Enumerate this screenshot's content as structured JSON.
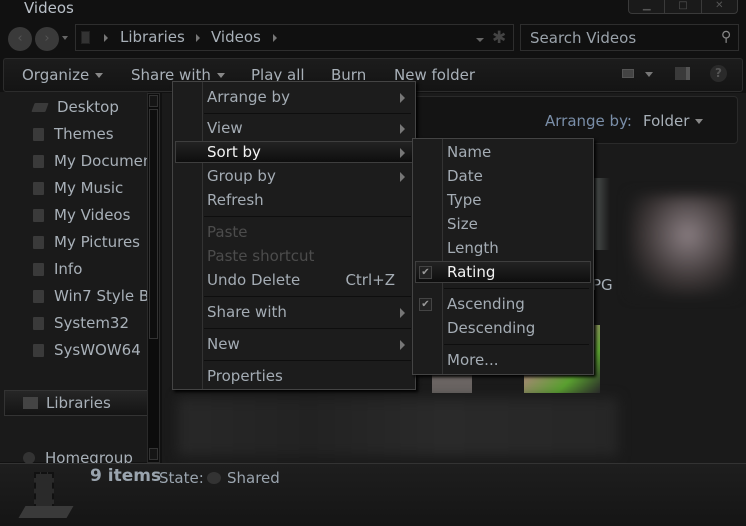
{
  "window": {
    "title": "Videos",
    "caption_buttons": [
      "minimize",
      "maximize",
      "close"
    ]
  },
  "address_bar": {
    "breadcrumb": [
      "Libraries",
      "Videos"
    ],
    "search_placeholder": "Search Videos"
  },
  "toolbar": {
    "organize": "Organize",
    "share_with": "Share with",
    "play_all": "Play all",
    "burn": "Burn",
    "new_folder": "New folder"
  },
  "nav_pane": {
    "favorites": [
      {
        "label": "Desktop",
        "icon": "desktop-icon"
      },
      {
        "label": "Themes",
        "icon": "folder-icon"
      },
      {
        "label": "My Documen",
        "icon": "documents-icon"
      },
      {
        "label": "My Music",
        "icon": "music-icon"
      },
      {
        "label": "My Videos",
        "icon": "videos-icon"
      },
      {
        "label": "My Pictures",
        "icon": "pictures-icon"
      },
      {
        "label": "Info",
        "icon": "folder-icon"
      },
      {
        "label": "Win7 Style B",
        "icon": "folder-icon"
      },
      {
        "label": "System32",
        "icon": "folder-icon"
      },
      {
        "label": "SysWOW64",
        "icon": "folder-icon"
      }
    ],
    "libraries": "Libraries",
    "homegroup": "Homegroup"
  },
  "content": {
    "arrange_label": "Arrange by:",
    "arrange_value": "Folder",
    "partial_filename": "PG"
  },
  "context_menu": {
    "items": [
      {
        "label": "Arrange by",
        "submenu": true
      },
      {
        "label": "View",
        "submenu": true
      },
      {
        "label": "Sort by",
        "submenu": true,
        "highlighted": true
      },
      {
        "label": "Group by",
        "submenu": true
      },
      {
        "label": "Refresh"
      },
      {
        "label": "Paste",
        "disabled": true
      },
      {
        "label": "Paste shortcut",
        "disabled": true
      },
      {
        "label": "Undo Delete",
        "shortcut": "Ctrl+Z"
      },
      {
        "label": "Share with",
        "submenu": true
      },
      {
        "label": "New",
        "submenu": true
      },
      {
        "label": "Properties"
      }
    ]
  },
  "sort_submenu": {
    "items": [
      {
        "label": "Name"
      },
      {
        "label": "Date"
      },
      {
        "label": "Type"
      },
      {
        "label": "Size"
      },
      {
        "label": "Length"
      },
      {
        "label": "Rating",
        "checked": true,
        "highlighted": true
      },
      {
        "label": "Ascending",
        "checked": true
      },
      {
        "label": "Descending"
      },
      {
        "label": "More..."
      }
    ]
  },
  "status_bar": {
    "item_count": "9 items",
    "state_label": "State:",
    "state_value": "Shared"
  }
}
